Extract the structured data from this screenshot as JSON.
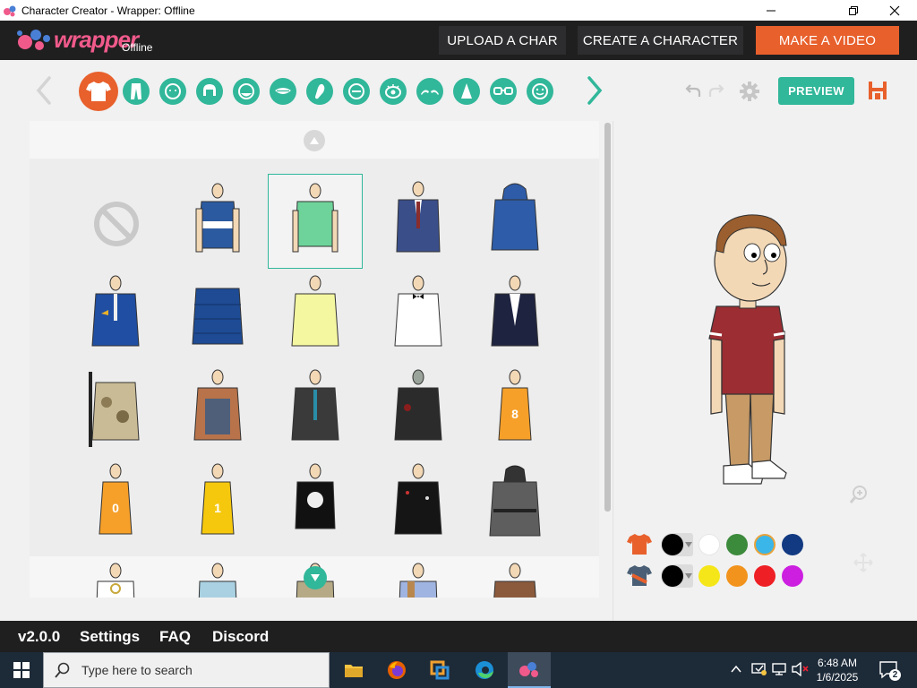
{
  "window": {
    "title": "Character Creator - Wrapper: Offline"
  },
  "header": {
    "logo_text": "wrapper",
    "logo_sub": "Offline",
    "upload_label": "UPLOAD A CHAR",
    "create_label": "CREATE A CHARACTER",
    "make_video_label": "MAKE A VIDEO"
  },
  "toolbar": {
    "categories": [
      "upper-body",
      "lower-body",
      "head",
      "hair",
      "face-shape",
      "mouth",
      "ear",
      "nose-bridge",
      "eye",
      "eyebrow",
      "nose",
      "glasses",
      "extras"
    ],
    "active_category": "upper-body",
    "preview_label": "PREVIEW"
  },
  "colors": {
    "accent": "#31b79a",
    "orange": "#e8602c",
    "header_bg": "#1f1f20",
    "row1": [
      "#000000",
      "#ffffff",
      "#3c8a3c",
      "#3bb6e8",
      "#123a82"
    ],
    "row1_selected": 3,
    "row2": [
      "#000000",
      "#f5e61a",
      "#f2931e",
      "#ee1f25",
      "#cc1fe0"
    ]
  },
  "footer": {
    "version": "v2.0.0",
    "settings": "Settings",
    "faq": "FAQ",
    "discord": "Discord"
  },
  "taskbar": {
    "search_placeholder": "Type here to search",
    "time": "6:48 AM",
    "date": "1/6/2025",
    "notification_count": "2"
  }
}
